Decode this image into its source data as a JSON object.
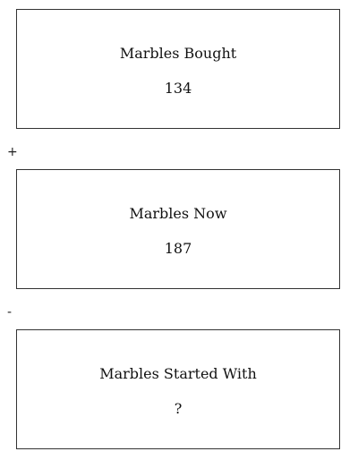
{
  "boxes": [
    {
      "label": "Marbles Bought",
      "value": "134"
    },
    {
      "label": "Marbles Now",
      "value": "187"
    },
    {
      "label": "Marbles Started With",
      "value": "?"
    }
  ],
  "operators": [
    "+",
    "-"
  ]
}
